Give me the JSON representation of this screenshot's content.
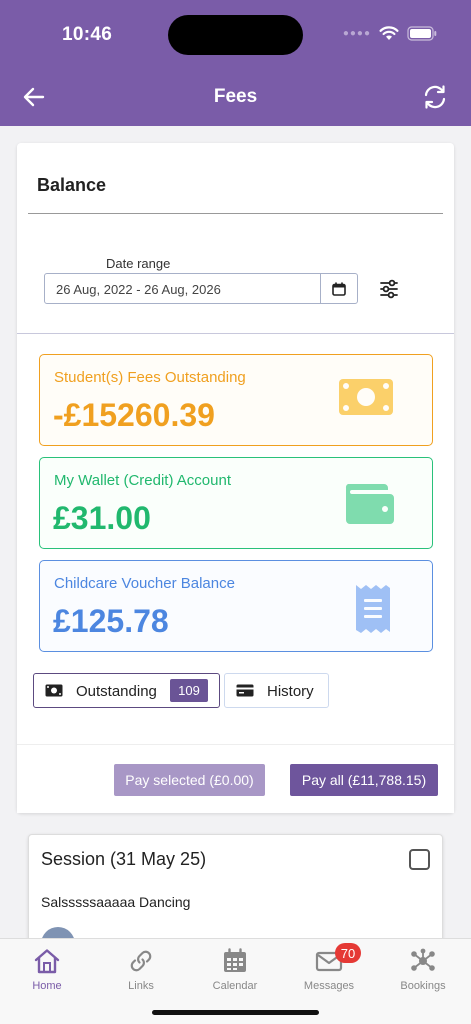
{
  "status": {
    "time": "10:46"
  },
  "header": {
    "title": "Fees",
    "back_icon": "arrow-left-icon",
    "refresh_icon": "refresh-icon"
  },
  "balance": {
    "title": "Balance",
    "date_label": "Date range",
    "date_value": "26 Aug, 2022 - 26 Aug, 2026",
    "cards": [
      {
        "label": "Student(s) Fees Outstanding",
        "amount": "-£15260.39",
        "icon": "money-icon",
        "color": "#f0a020"
      },
      {
        "label": "My Wallet (Credit) Account",
        "amount": "£31.00",
        "icon": "wallet-icon",
        "color": "#29c17a"
      },
      {
        "label": "Childcare Voucher Balance",
        "amount": "£125.78",
        "icon": "receipt-icon",
        "color": "#5b8fe0"
      }
    ]
  },
  "tabs": [
    {
      "label": "Outstanding",
      "badge": "109",
      "icon": "money-icon"
    },
    {
      "label": "History",
      "icon": "card-icon"
    }
  ],
  "pay": {
    "selected_label": "Pay selected (£0.00)",
    "all_label": "Pay all (£11,788.15)"
  },
  "session": {
    "title": "Session (31 May 25)",
    "subtitle": "Salsssssaaaaa Dancing"
  },
  "nav": [
    {
      "label": "Home",
      "icon": "home-icon",
      "active": true
    },
    {
      "label": "Links",
      "icon": "link-icon"
    },
    {
      "label": "Calendar",
      "icon": "calendar-icon"
    },
    {
      "label": "Messages",
      "icon": "mail-icon",
      "badge": "70"
    },
    {
      "label": "Bookings",
      "icon": "network-icon"
    }
  ],
  "colors": {
    "brand": "#7a5ca8",
    "accent": "#6e559c"
  }
}
